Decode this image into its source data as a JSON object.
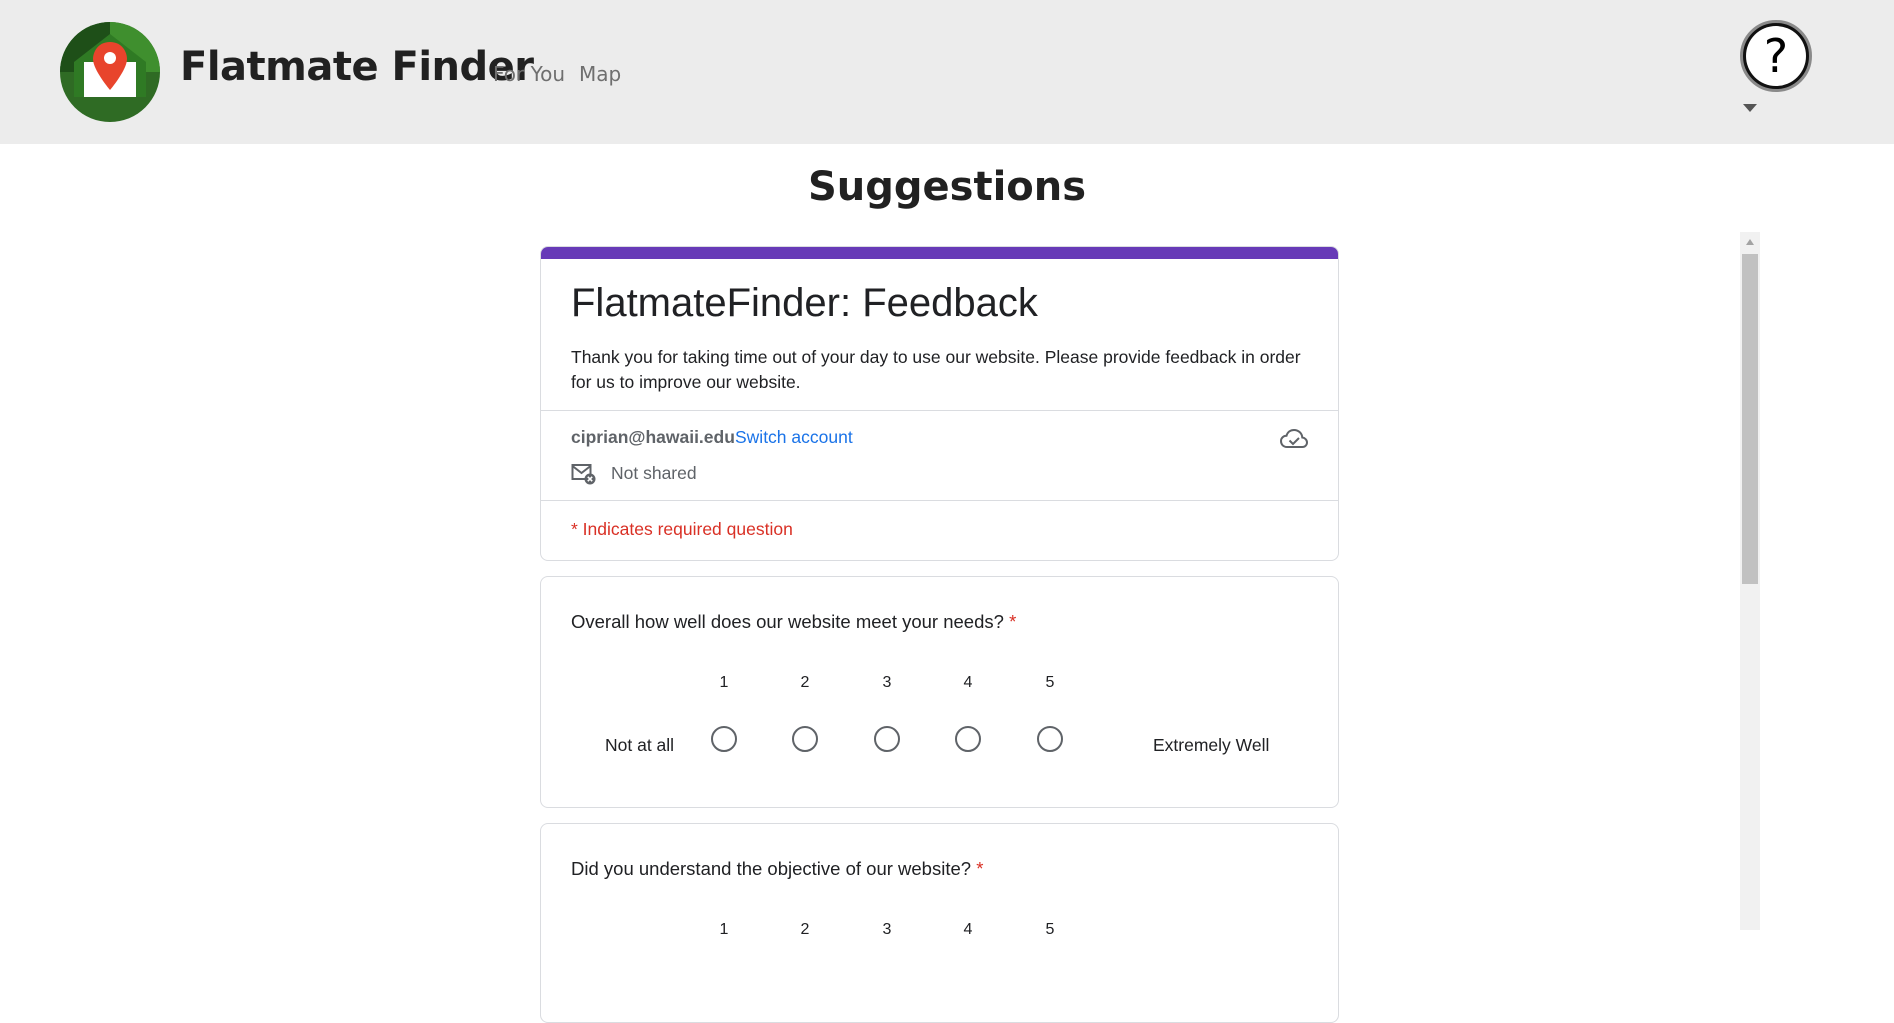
{
  "app": {
    "brand": "Flatmate Finder",
    "nav": [
      {
        "label": "For You"
      },
      {
        "label": "Map"
      }
    ],
    "help_glyph": "?",
    "logo_icon": "house-location-pin-icon"
  },
  "page": {
    "title": "Suggestions"
  },
  "form": {
    "title": "FlatmateFinder: Feedback",
    "description": "Thank you for taking time out of your day to use our website. Please provide feedback in order for us to improve our website.",
    "account_email": "ciprian@hawaii.edu",
    "switch_account_label": "Switch account",
    "not_shared_label": "Not shared",
    "required_note": "* Indicates required question",
    "accent_color": "#673ab7",
    "questions": [
      {
        "text": "Overall how well does our website meet your needs?",
        "required_mark": "*",
        "scale": [
          "1",
          "2",
          "3",
          "4",
          "5"
        ],
        "low_label": "Not at all",
        "high_label": "Extremely Well"
      },
      {
        "text": "Did you understand the objective of our website?",
        "required_mark": "*",
        "scale": [
          "1",
          "2",
          "3",
          "4",
          "5"
        ]
      }
    ]
  }
}
